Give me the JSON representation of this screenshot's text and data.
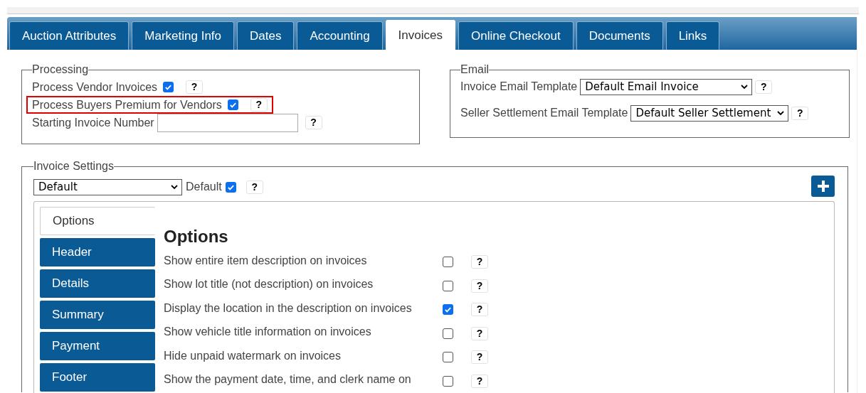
{
  "tabs": [
    {
      "label": "Auction Attributes",
      "selected": false
    },
    {
      "label": "Marketing Info",
      "selected": false
    },
    {
      "label": "Dates",
      "selected": false
    },
    {
      "label": "Accounting",
      "selected": false
    },
    {
      "label": "Invoices",
      "selected": true
    },
    {
      "label": "Online Checkout",
      "selected": false
    },
    {
      "label": "Documents",
      "selected": false
    },
    {
      "label": "Links",
      "selected": false
    }
  ],
  "processing": {
    "legend": "Processing",
    "rows": [
      {
        "kind": "checkbox",
        "label": "Process Vendor Invoices",
        "checked": true,
        "highlighted": false,
        "help": "?"
      },
      {
        "kind": "checkbox",
        "label": "Process Buyers Premium for Vendors",
        "checked": true,
        "highlighted": true,
        "help": "?"
      },
      {
        "kind": "input",
        "label": "Starting Invoice Number",
        "help": "?"
      }
    ]
  },
  "email": {
    "legend": "Email",
    "rows": [
      {
        "label": "Invoice Email Template",
        "value": "Default Email Invoice",
        "help": "?"
      },
      {
        "label": "Seller Settlement Email Template",
        "value": "Default Seller Settlement",
        "help": "?"
      }
    ]
  },
  "invoice_settings": {
    "legend": "Invoice Settings",
    "select_value": "Default",
    "default_label": "Default",
    "default_checked": true,
    "help": "?",
    "side_tabs": [
      {
        "label": "Options",
        "selected": true
      },
      {
        "label": "Header",
        "selected": false
      },
      {
        "label": "Details",
        "selected": false
      },
      {
        "label": "Summary",
        "selected": false
      },
      {
        "label": "Payment",
        "selected": false
      },
      {
        "label": "Footer",
        "selected": false
      }
    ],
    "panel": {
      "title": "Options",
      "options": [
        {
          "label": "Show entire item description on invoices",
          "checked": false,
          "help": "?"
        },
        {
          "label": "Show lot title (not description) on invoices",
          "checked": false,
          "help": "?"
        },
        {
          "label": "Display the location in the description on invoices",
          "checked": true,
          "help": "?"
        },
        {
          "label": "Show vehicle title information on invoices",
          "checked": false,
          "help": "?"
        },
        {
          "label": "Hide unpaid watermark on invoices",
          "checked": false,
          "help": "?"
        },
        {
          "label": "Show the payment date, time, and clerk name on",
          "checked": false,
          "help": "?"
        }
      ]
    }
  }
}
